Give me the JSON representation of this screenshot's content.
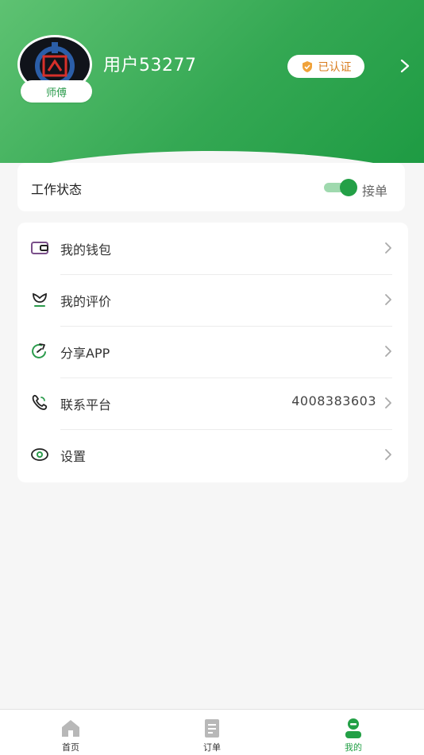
{
  "header": {
    "username": "用户53277",
    "role": "师傅",
    "certified": "已认证"
  },
  "status": {
    "label": "工作状态",
    "value": "接单",
    "toggle_on": true
  },
  "menu": {
    "items": [
      {
        "label": "我的钱包",
        "icon": "wallet-icon"
      },
      {
        "label": "我的评价",
        "icon": "review-icon"
      },
      {
        "label": "分享APP",
        "icon": "share-icon"
      },
      {
        "label": "联系平台",
        "icon": "phone-icon",
        "value": "4008383603"
      },
      {
        "label": "设置",
        "icon": "settings-icon"
      }
    ]
  },
  "tabbar": {
    "tabs": [
      {
        "label": "首页",
        "icon": "home-icon",
        "active": false
      },
      {
        "label": "订单",
        "icon": "order-icon",
        "active": false
      },
      {
        "label": "我的",
        "icon": "profile-icon",
        "active": true
      }
    ]
  },
  "colors": {
    "brand_green": "#23a046",
    "cert_orange": "#d87c1f"
  }
}
